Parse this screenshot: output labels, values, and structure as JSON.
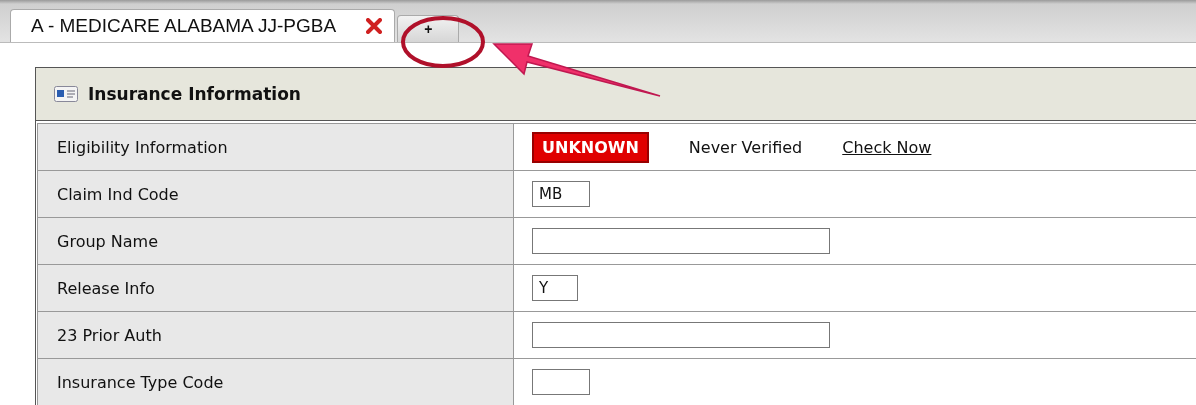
{
  "tabs": [
    {
      "label": "A - MEDICARE ALABAMA JJ-PGBA",
      "selected": true
    },
    {
      "label": "+",
      "selected": false
    }
  ],
  "annotation": {
    "kind": "circle-arrow"
  },
  "panel": {
    "title": "Insurance Information"
  },
  "rows": [
    {
      "label": "Eligibility Information",
      "kind": "eligibility",
      "badge": "UNKNOWN",
      "status": "Never Verified",
      "link": "Check Now"
    },
    {
      "label": "Claim Ind Code",
      "kind": "short-field",
      "value": "MB"
    },
    {
      "label": "Group Name",
      "kind": "long-field",
      "value": ""
    },
    {
      "label": "Release Info",
      "kind": "tiny-field",
      "value": "Y"
    },
    {
      "label": "23 Prior Auth",
      "kind": "long-field",
      "value": ""
    },
    {
      "label": "Insurance Type Code",
      "kind": "short-field",
      "value": ""
    }
  ]
}
